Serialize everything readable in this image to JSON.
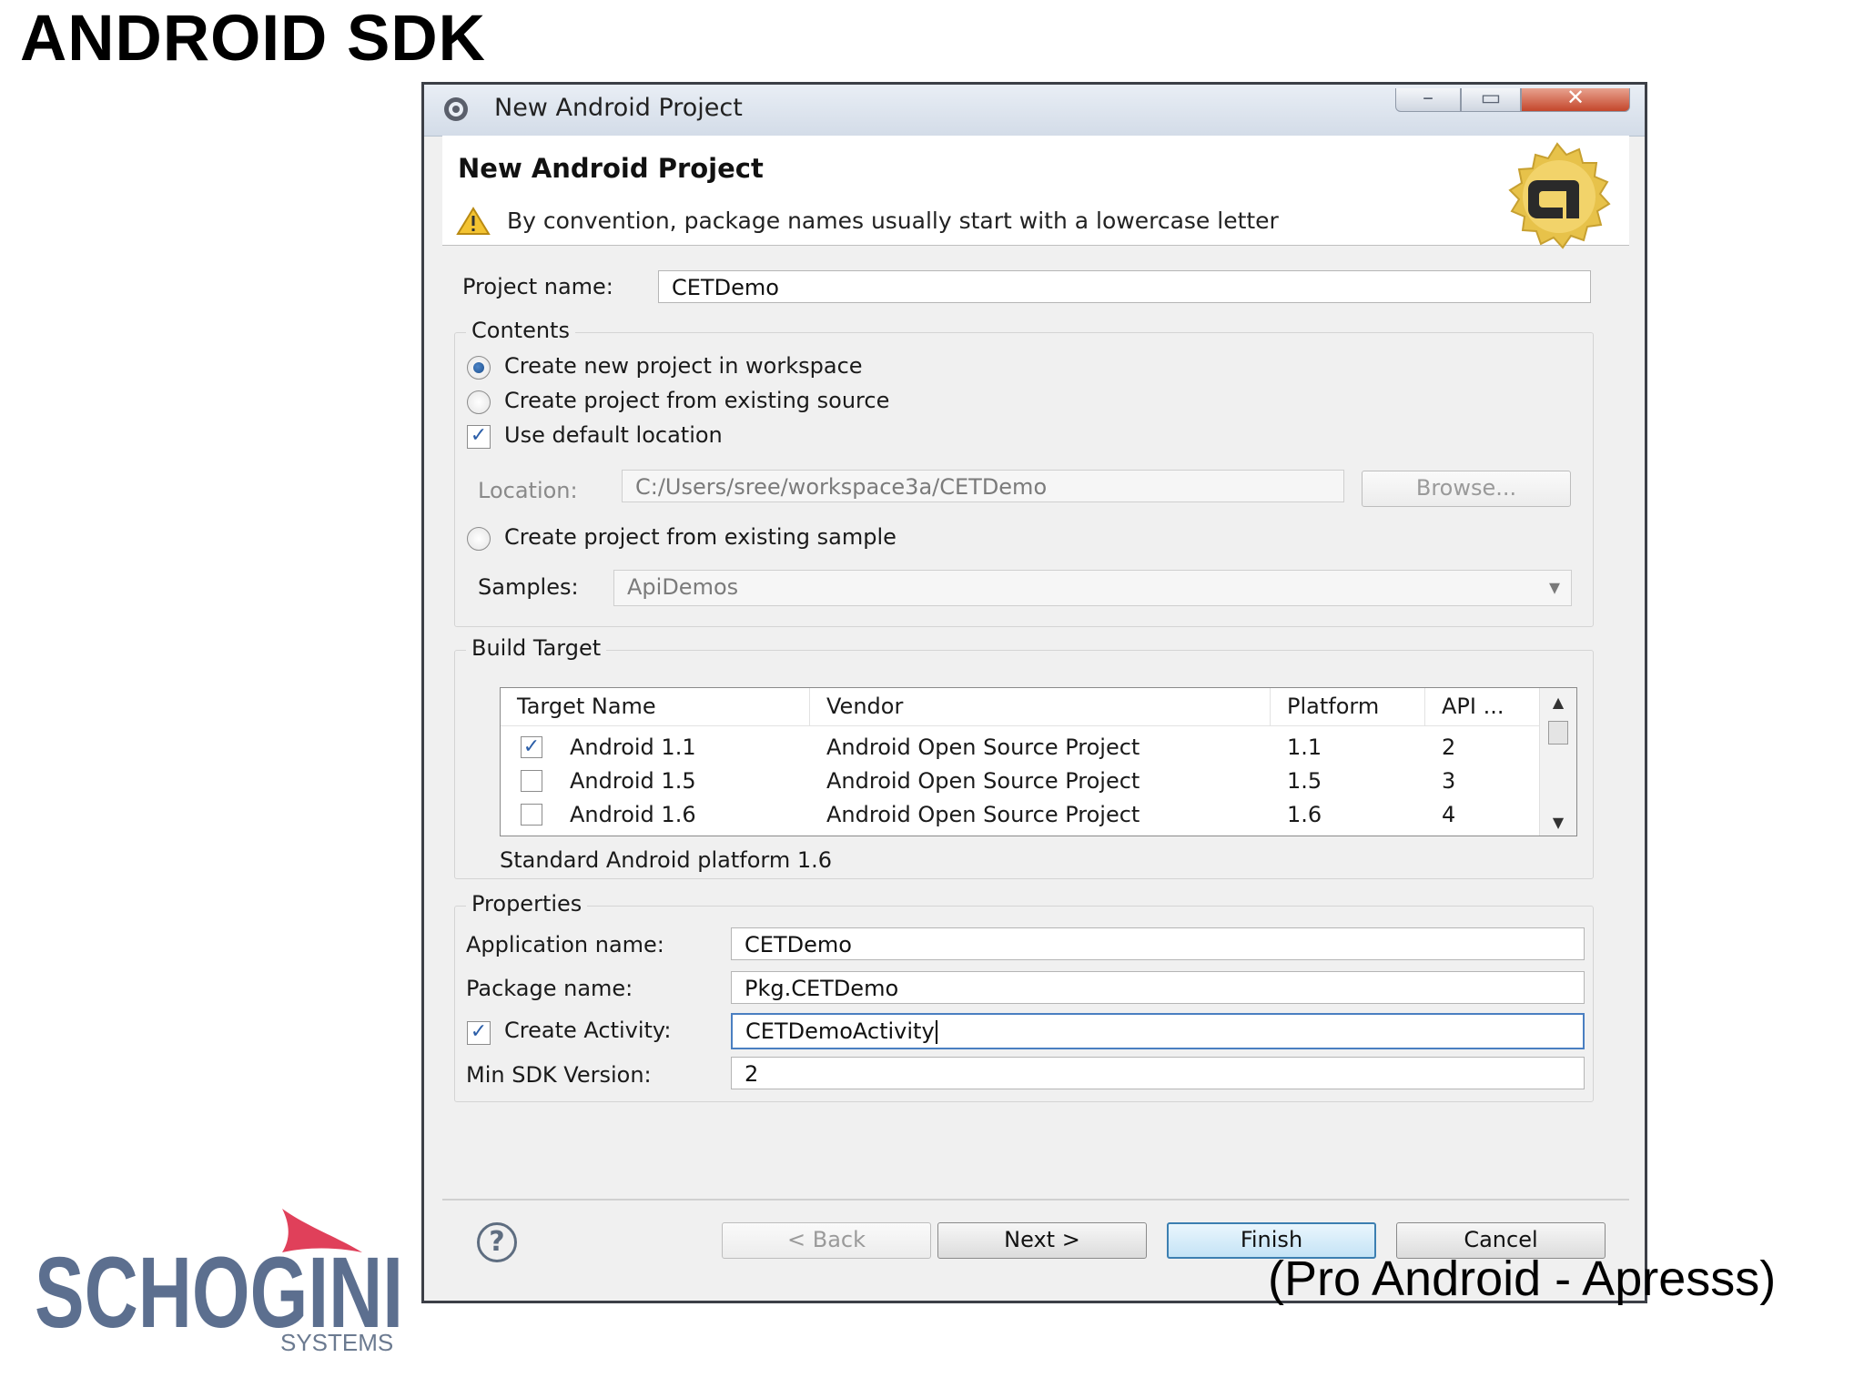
{
  "slide": {
    "title": "ANDROID SDK",
    "citation": "(Pro Android - Apresss)"
  },
  "brand": {
    "name": "SCHOGINI",
    "subtitle": "SYSTEMS"
  },
  "window": {
    "title": "New Android Project",
    "controls": {
      "minimize": "–",
      "maximize": "▭",
      "close": "✕"
    }
  },
  "header": {
    "title": "New Android Project",
    "warning": "By convention, package names usually start with a lowercase letter"
  },
  "project_name": {
    "label": "Project name:",
    "value": "CETDemo"
  },
  "contents": {
    "group_title": "Contents",
    "radio_new": "Create new project in workspace",
    "radio_existing_source": "Create project from existing source",
    "use_default_location": "Use default location",
    "location_label": "Location:",
    "location_value": "C:/Users/sree/workspace3a/CETDemo",
    "browse_label": "Browse...",
    "radio_existing_sample": "Create project from existing sample",
    "samples_label": "Samples:",
    "samples_value": "ApiDemos"
  },
  "build_target": {
    "group_title": "Build Target",
    "columns": [
      "Target Name",
      "Vendor",
      "Platform",
      "API ..."
    ],
    "rows": [
      {
        "checked": true,
        "name": "Android 1.1",
        "vendor": "Android Open Source Project",
        "platform": "1.1",
        "api": "2"
      },
      {
        "checked": false,
        "name": "Android 1.5",
        "vendor": "Android Open Source Project",
        "platform": "1.5",
        "api": "3"
      },
      {
        "checked": false,
        "name": "Android 1.6",
        "vendor": "Android Open Source Project",
        "platform": "1.6",
        "api": "4"
      }
    ],
    "description": "Standard Android platform 1.6"
  },
  "properties": {
    "group_title": "Properties",
    "app_name_label": "Application name:",
    "app_name_value": "CETDemo",
    "package_label": "Package name:",
    "package_value": "Pkg.CETDemo",
    "create_activity_label": "Create Activity:",
    "create_activity_value": "CETDemoActivity",
    "min_sdk_label": "Min SDK Version:",
    "min_sdk_value": "2"
  },
  "footer": {
    "help": "?",
    "back": "< Back",
    "next": "Next >",
    "finish": "Finish",
    "cancel": "Cancel"
  },
  "colors": {
    "window_border": "#3c3f46",
    "dialog_bg": "#f0f0f0",
    "accent_blue": "#3c7fb1",
    "brand_blue": "#5c6f8f",
    "brand_red": "#e0405a"
  }
}
